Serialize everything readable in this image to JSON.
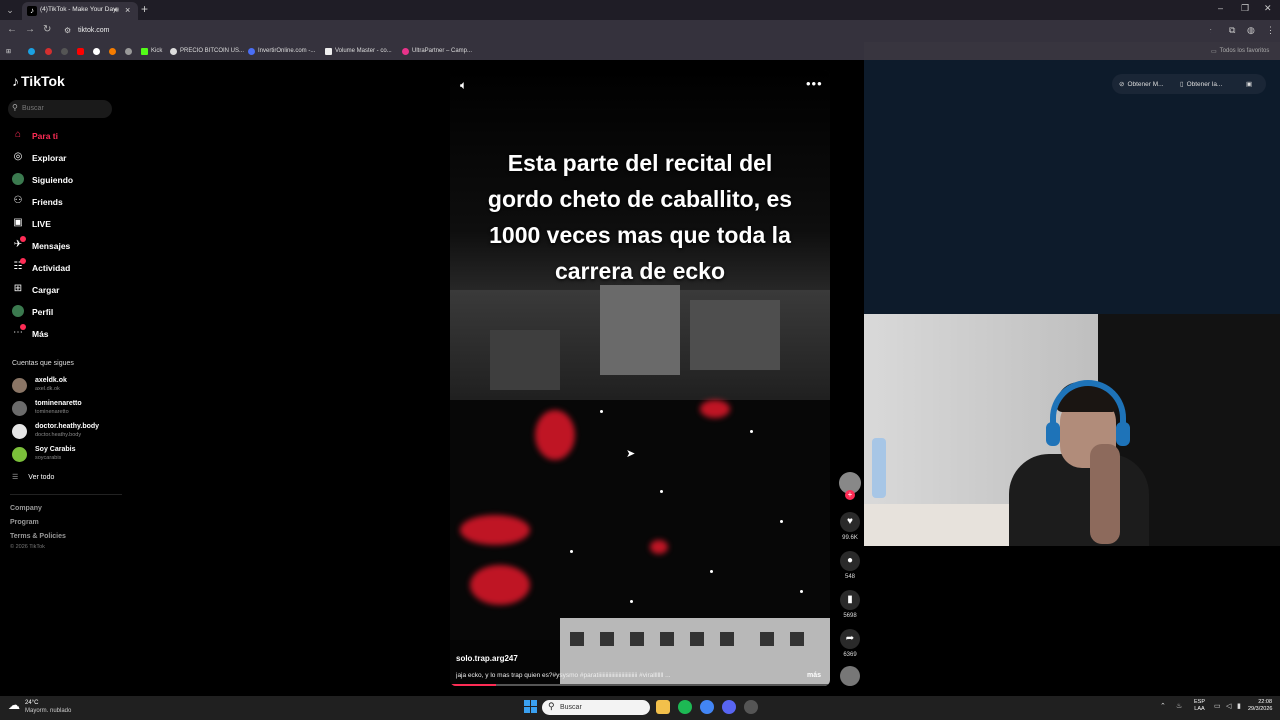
{
  "browser": {
    "tab_title": "(4)TikTok - Make Your Day",
    "url": "tiktok.com",
    "bookmarks": [
      {
        "label": "Kick",
        "color": "#53fc18"
      },
      {
        "label": "PRECIO BITCOIN US...",
        "color": "#dddddd"
      },
      {
        "label": "InvertirOnline.com -...",
        "color": "#4a6ef5"
      },
      {
        "label": "Volume Master - co...",
        "color": "#eeeeee"
      },
      {
        "label": "UltraPartner – Camp...",
        "color": "#e8338a"
      }
    ],
    "all_bookmarks": "Todos los favoritos"
  },
  "tiktok": {
    "logo": "TikTok",
    "search_placeholder": "Buscar",
    "nav": [
      {
        "label": "Para ti",
        "icon": "home-icon",
        "active": true
      },
      {
        "label": "Explorar",
        "icon": "compass-icon"
      },
      {
        "label": "Siguiendo",
        "icon": "following-avatar-icon"
      },
      {
        "label": "Friends",
        "icon": "friends-icon"
      },
      {
        "label": "LIVE",
        "icon": "live-icon"
      },
      {
        "label": "Mensajes",
        "icon": "messages-icon"
      },
      {
        "label": "Actividad",
        "icon": "activity-icon"
      },
      {
        "label": "Cargar",
        "icon": "upload-icon"
      },
      {
        "label": "Perfil",
        "icon": "profile-icon"
      },
      {
        "label": "Más",
        "icon": "more-icon"
      }
    ],
    "following_header": "Cuentas que sigues",
    "following": [
      {
        "name": "axeldk.ok",
        "handle": "axel.dk.ok",
        "color": "#8a7565"
      },
      {
        "name": "tominenaretto",
        "handle": "tominenaretto",
        "color": "#6b6b6b"
      },
      {
        "name": "doctor.heathy.body",
        "handle": "doctor.heathy.body",
        "color": "#e5e5e5"
      },
      {
        "name": "Soy Carabis",
        "handle": "soycarabis",
        "color": "#7bbf3a"
      }
    ],
    "see_all": "Ver todo",
    "footer_links": [
      "Company",
      "Program",
      "Terms & Policies"
    ],
    "copyright": "© 2026 TikTok"
  },
  "video": {
    "caption_lines": [
      "Esta parte del recital del",
      "gordo cheto de caballito, es",
      "1000 veces mas que toda la",
      "carrera de ecko"
    ],
    "author": "solo.trap.arg247",
    "description": "jaja ecko, y lo mas trap quien es?#ysysmo #paratiiiiiiiiiiiiiiiiiiiiiiiiiii #viralllllll ...",
    "more": "más",
    "progress_fraction": 0.12,
    "likes": "99.6K",
    "comments": "548",
    "saves": "5698",
    "shares": "6369"
  },
  "extensions": {
    "btn1": "Obtener M...",
    "btn2": "Obtener la..."
  },
  "taskbar": {
    "temp": "24°C",
    "weather": "Mayorm. nublado",
    "search_placeholder": "Buscar",
    "lang_line1": "ESP",
    "lang_line2": "LAA",
    "time": "22:08",
    "date": "29/3/2026"
  }
}
